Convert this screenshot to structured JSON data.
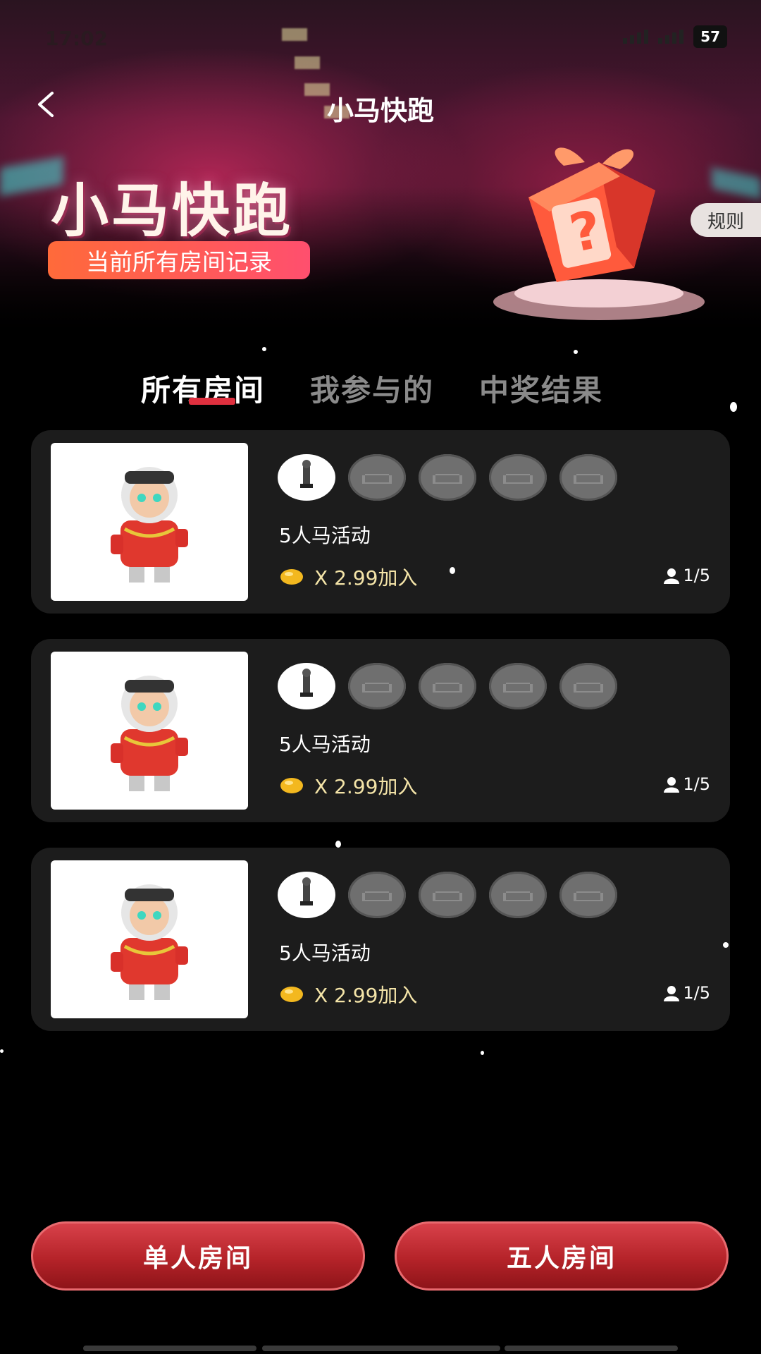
{
  "status_bar": {
    "time": "17:02",
    "battery": "57"
  },
  "header": {
    "title": "小马快跑"
  },
  "banner": {
    "hero_title": "小马快跑",
    "tagline": "当前所有房间记录",
    "rules_label": "规则"
  },
  "tabs": [
    {
      "label": "所有房间",
      "active": true
    },
    {
      "label": "我参与的",
      "active": false
    },
    {
      "label": "中奖结果",
      "active": false
    }
  ],
  "rooms": [
    {
      "title": "5人马活动",
      "price": "X 2.99加入",
      "count": "1/5"
    },
    {
      "title": "5人马活动",
      "price": "X 2.99加入",
      "count": "1/5"
    },
    {
      "title": "5人马活动",
      "price": "X 2.99加入",
      "count": "1/5"
    }
  ],
  "buttons": {
    "single": "单人房间",
    "five": "五人房间"
  },
  "colors": {
    "accent": "#e0303f",
    "button_red": "#b52329",
    "card_bg": "#1c1c1c",
    "price_text": "#f4e4a8"
  },
  "icons": {
    "back": "chevron-left-icon",
    "coin": "gold-bean-icon",
    "user": "user-icon",
    "seat_empty": "sofa-icon"
  }
}
